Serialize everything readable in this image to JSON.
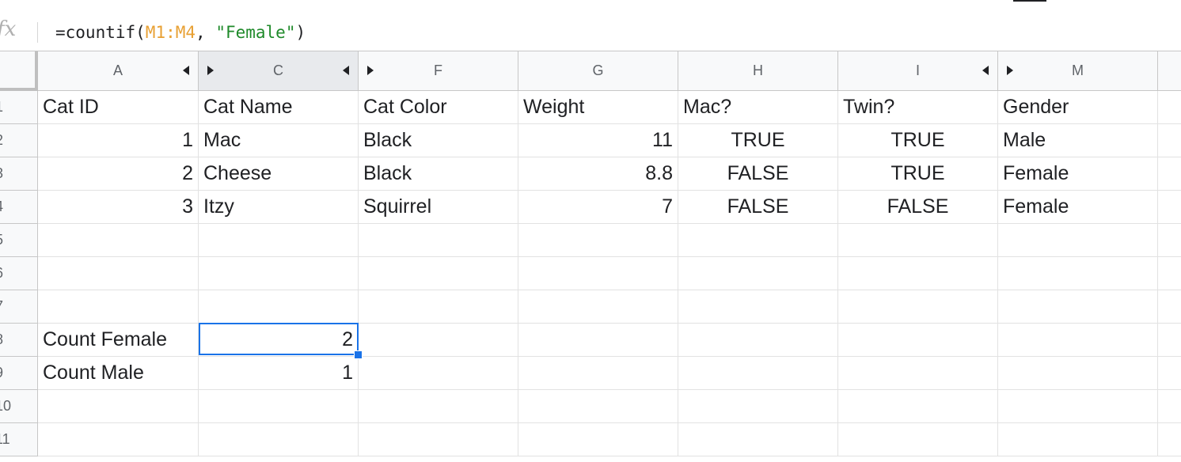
{
  "formula_bar": {
    "fx_label": "fx",
    "prefix": "=countif(",
    "range_ref": "M1:M4",
    "separator": ", ",
    "criterion": "\"Female\"",
    "suffix": ")"
  },
  "columns": [
    {
      "letter": "A"
    },
    {
      "letter": "C"
    },
    {
      "letter": "F"
    },
    {
      "letter": "G"
    },
    {
      "letter": "H"
    },
    {
      "letter": "I"
    },
    {
      "letter": "M"
    }
  ],
  "rows": [
    {
      "num": "1",
      "cells": [
        "Cat ID",
        "Cat Name",
        "Cat Color",
        "Weight",
        "Mac?",
        "Twin?",
        "Gender"
      ]
    },
    {
      "num": "2",
      "cells": [
        "1",
        "Mac",
        "Black",
        "11",
        "TRUE",
        "TRUE",
        "Male"
      ]
    },
    {
      "num": "3",
      "cells": [
        "2",
        "Cheese",
        "Black",
        "8.8",
        "FALSE",
        "TRUE",
        "Female"
      ]
    },
    {
      "num": "4",
      "cells": [
        "3",
        "Itzy",
        "Squirrel",
        "7",
        "FALSE",
        "FALSE",
        "Female"
      ]
    },
    {
      "num": "5",
      "cells": [
        "",
        "",
        "",
        "",
        "",
        "",
        ""
      ]
    },
    {
      "num": "6",
      "cells": [
        "",
        "",
        "",
        "",
        "",
        "",
        ""
      ]
    },
    {
      "num": "7",
      "cells": [
        "",
        "",
        "",
        "",
        "",
        "",
        ""
      ]
    },
    {
      "num": "8",
      "cells": [
        "Count Female",
        "2",
        "",
        "",
        "",
        "",
        ""
      ]
    },
    {
      "num": "9",
      "cells": [
        "Count Male",
        "1",
        "",
        "",
        "",
        "",
        ""
      ]
    },
    {
      "num": "10",
      "cells": [
        "",
        "",
        "",
        "",
        "",
        "",
        ""
      ]
    },
    {
      "num": "11",
      "cells": [
        "",
        "",
        "",
        "",
        "",
        "",
        ""
      ]
    }
  ],
  "selected_cell": "C8"
}
